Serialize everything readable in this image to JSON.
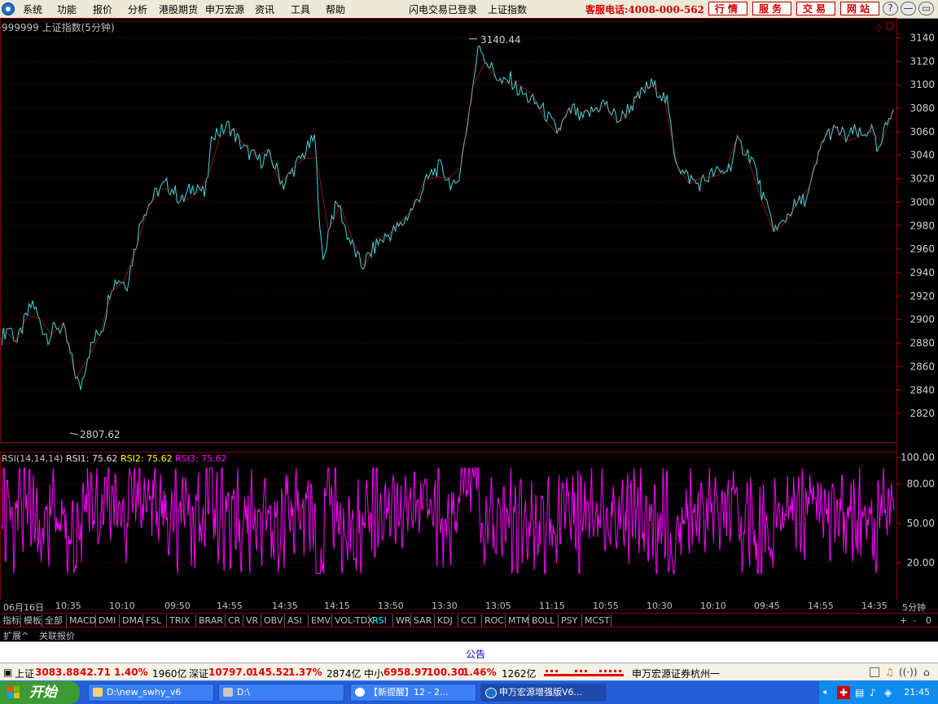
{
  "menu": [
    "系统",
    "功能",
    "报价",
    "分析",
    "港股期货",
    "申万宏源",
    "资讯",
    "工具",
    "帮助"
  ],
  "center_status": [
    "闪电交易已登录",
    "上证指数"
  ],
  "hotline": "客服电话:4008-000-562",
  "top_buttons": [
    "行情",
    "服务",
    "交易",
    "网站"
  ],
  "window_buttons": [
    "?",
    "—",
    "▭",
    "×"
  ],
  "chart_title": "999999 上证指数(5分钟)",
  "price_axis": [
    "3140",
    "3120",
    "3100",
    "3080",
    "3060",
    "3040",
    "3020",
    "3000",
    "2980",
    "2960",
    "2940",
    "2920",
    "2900",
    "2880",
    "2860",
    "2840",
    "2820"
  ],
  "high_marker": "3140.44",
  "low_marker": "2807.62",
  "rsi": {
    "name": "RSI(14,14,14)",
    "rsi1": "RSI1: 75.62",
    "rsi2": "RSI2: 75.62",
    "rsi3": "RSI3: 75.62",
    "axis": [
      "100.00",
      "80.00",
      "50.00",
      "20.00"
    ]
  },
  "time_axis": [
    "06月16日",
    "10:35",
    "10:10",
    "09:50",
    "14:55",
    "14:35",
    "14:15",
    "13:50",
    "13:30",
    "13:05",
    "11:15",
    "10:55",
    "10:30",
    "10:10",
    "09:45",
    "14:55",
    "14:35"
  ],
  "period": "5分钟",
  "indicator_tabs": [
    "指标",
    "模板",
    "全部",
    "MACD",
    "DMI",
    "DMA",
    "FSL",
    "TRIX",
    "BRAR",
    "CR",
    "VR",
    "OBV",
    "ASI",
    "EMV",
    "VOL-TDX",
    "RSI",
    "WR",
    "SAR",
    "KDJ",
    "CCI",
    "ROC",
    "MTM",
    "BOLL",
    "PSY",
    "MCST"
  ],
  "active_tab": "RSI",
  "tab_controls": [
    "+",
    "-",
    "0"
  ],
  "sub_tabs": [
    "扩展^",
    "关联报价"
  ],
  "notice": "公告",
  "status": {
    "sh_label": "上证",
    "sh_value": "3083.88",
    "sh_change": "42.71",
    "sh_pct": "1.40%",
    "sh_vol": "1960亿",
    "sz_label": "深证",
    "sz_value": "10797.0",
    "sz_change": "145.52",
    "sz_pct": "1.37%",
    "sz_vol": "2874亿",
    "zx_label": "中小",
    "zx_value": "6958.97",
    "zx_change": "100.30",
    "zx_pct": "1.46%",
    "zx_vol": "1262亿",
    "broker": "申万宏源证券杭州一"
  },
  "taskbar": {
    "start": "开始",
    "tasks": [
      "D:\\new_swhy_v6",
      "D:\\",
      "【新提醒】12 - 2...",
      "申万宏源增强版V6..."
    ],
    "clock": "21:45"
  },
  "chart_data": {
    "type": "line",
    "title": "999999 上证指数(5分钟)",
    "ylim": [
      2800,
      3150
    ],
    "y_ticks": [
      2820,
      2840,
      2860,
      2880,
      2900,
      2920,
      2940,
      2960,
      2980,
      3000,
      3020,
      3040,
      3060,
      3080,
      3100,
      3120,
      3140
    ],
    "x_ticks": [
      "06月16日",
      "10:35",
      "10:10",
      "09:50",
      "14:55",
      "14:35",
      "14:15",
      "13:50",
      "13:30",
      "13:05",
      "11:15",
      "10:55",
      "10:30",
      "10:10",
      "09:45",
      "14:55",
      "14:35"
    ],
    "series": [
      {
        "values": [
          2885,
          2895,
          2880,
          2900,
          2915,
          2895,
          2885,
          2895,
          2890,
          2865,
          2840,
          2870,
          2885,
          2895,
          2930,
          2935,
          2930,
          2960,
          2990,
          3000,
          3010,
          3015,
          3010,
          3000,
          3010,
          3015,
          3005,
          3060,
          3060,
          3065,
          3055,
          3045,
          3040,
          3035,
          3040,
          3030,
          3015,
          3025,
          3035,
          3045,
          3055,
          2945,
          2985,
          3000,
          2975,
          2960,
          2945,
          2955,
          2965,
          2970,
          2975,
          2980,
          2990,
          3000,
          3015,
          3025,
          3030,
          3020,
          3010,
          3045,
          3090,
          3135,
          3120,
          3110,
          3100,
          3105,
          3095,
          3090,
          3085,
          3080,
          3070,
          3060,
          3070,
          3080,
          3070,
          3075,
          3080,
          3085,
          3075,
          3070,
          3080,
          3085,
          3095,
          3100,
          3095,
          3085,
          3040,
          3025,
          3020,
          3015,
          3020,
          3025,
          3025,
          3030,
          3050,
          3045,
          3035,
          3010,
          2990,
          2975,
          2985,
          2995,
          3000,
          3005,
          3030,
          3055,
          3060,
          3060,
          3055,
          3060,
          3055,
          3065,
          3040,
          3065,
          3085
        ]
      }
    ],
    "markers": {
      "high": 3140.44,
      "low": 2807.62
    },
    "rsi": {
      "name": "RSI(14,14,14)",
      "ylim": [
        0,
        100
      ],
      "y_ticks": [
        20,
        50,
        80,
        100
      ],
      "last_values": {
        "RSI1": 75.62,
        "RSI2": 75.62,
        "RSI3": 75.62
      }
    }
  }
}
